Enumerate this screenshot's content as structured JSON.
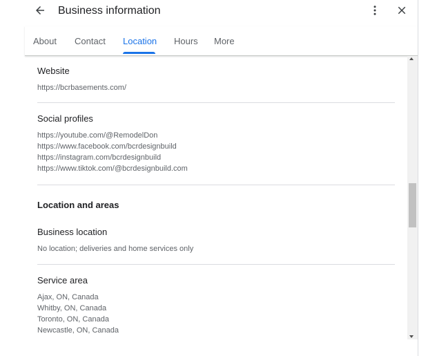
{
  "header": {
    "title": "Business information",
    "back_icon": "arrow-back-icon",
    "more_icon": "more-vert-icon",
    "close_icon": "close-icon"
  },
  "tabs": [
    {
      "label": "About",
      "active": false
    },
    {
      "label": "Contact",
      "active": false
    },
    {
      "label": "Location",
      "active": true
    },
    {
      "label": "Hours",
      "active": false
    },
    {
      "label": "More",
      "active": false
    }
  ],
  "website": {
    "label": "Website",
    "url": "https://bcrbasements.com/"
  },
  "social": {
    "label": "Social profiles",
    "links": [
      "https://youtube.com/@RemodelDon",
      "https://www.facebook.com/bcrdesignbuild",
      "https://instagram.com/bcrdesignbuild",
      "https://www.tiktok.com/@bcrdesignbuild.com"
    ]
  },
  "location_and_areas": {
    "heading": "Location and areas"
  },
  "business_location": {
    "label": "Business location",
    "value": "No location; deliveries and home services only"
  },
  "service_area": {
    "label": "Service area",
    "areas": [
      "Ajax, ON, Canada",
      "Whitby, ON, Canada",
      "Toronto, ON, Canada",
      "Newcastle, ON, Canada"
    ]
  },
  "colors": {
    "accent": "#1a73e8",
    "text_primary": "#202124",
    "text_secondary": "#5f6368",
    "divider": "#dadce0"
  }
}
